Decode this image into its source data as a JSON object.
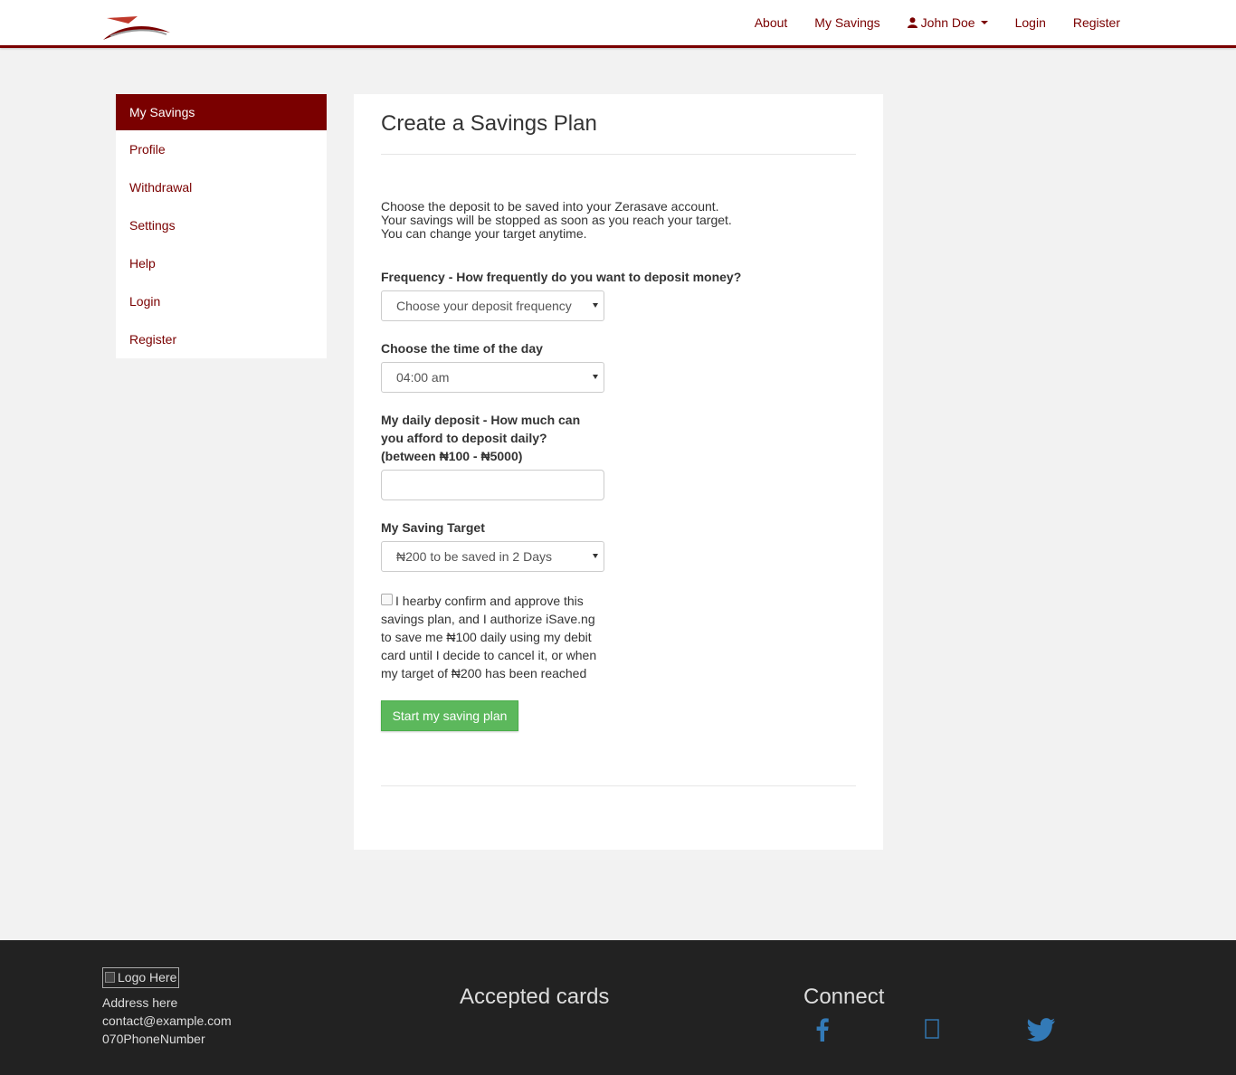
{
  "navbar": {
    "links": [
      "About",
      "My Savings",
      "John Doe",
      "Login",
      "Register"
    ]
  },
  "sidebar": {
    "items": [
      "My Savings",
      "Profile",
      "Withdrawal",
      "Settings",
      "Help",
      "Login",
      "Register"
    ]
  },
  "main": {
    "title": "Create a Savings Plan",
    "intro": [
      "Choose the deposit to be saved into your Zerasave account.",
      "Your savings will be stopped as soon as you reach your target.",
      "You can change your target anytime."
    ],
    "frequency_label": "Frequency - How frequently do you want to deposit money?",
    "frequency_value": "Choose your deposit frequency",
    "time_label": "Choose the time of the day",
    "time_value": "04:00 am",
    "deposit_label": [
      "My daily deposit - How much can",
      "you afford to deposit daily?",
      "(between ₦100 - ₦5000)"
    ],
    "deposit_value": "",
    "target_label": "My Saving Target",
    "target_value": "₦200 to be saved in 2 Days",
    "confirm_text": "I hearby confirm and approve this savings plan, and I authorize iSave.ng to save me ₦100 daily using my debit card until I decide to cancel it, or when my target of ₦200 has been reached",
    "submit_label": "Start my saving plan"
  },
  "footer": {
    "logo_alt": "Logo Here",
    "address": "Address here",
    "email": "contact@example.com",
    "phone": "070PhoneNumber",
    "cards_heading": "Accepted cards",
    "connect_heading": "Connect"
  },
  "colors": {
    "brand": "#7a0000",
    "success": "#5cb85c",
    "footer_bg": "#222222",
    "social_blue": "#337ab7"
  }
}
